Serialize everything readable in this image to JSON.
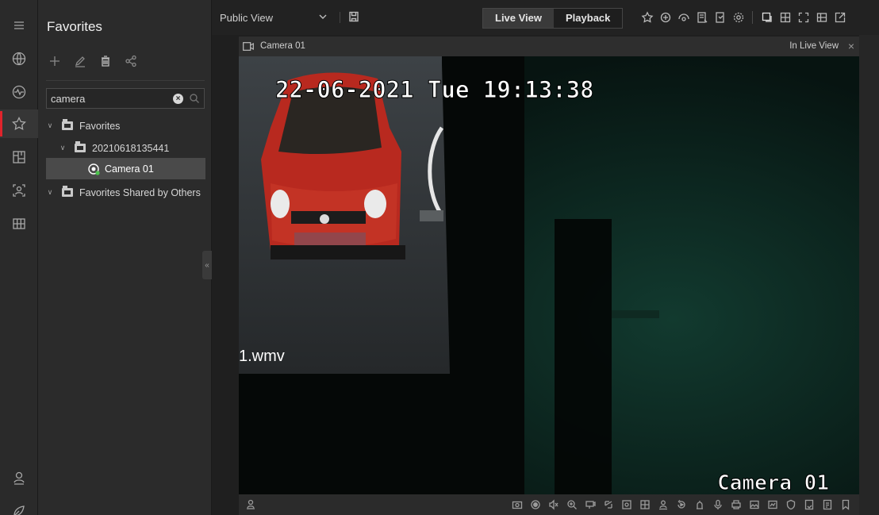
{
  "rail": {
    "items": [
      {
        "icon": "menu-icon"
      },
      {
        "icon": "globe-icon"
      },
      {
        "icon": "pulse-icon"
      },
      {
        "icon": "star-icon",
        "active": true
      },
      {
        "icon": "layout-icon"
      },
      {
        "icon": "person-scan-icon"
      },
      {
        "icon": "grid-icon"
      },
      {
        "icon": "user-icon"
      },
      {
        "icon": "settings-leaf-icon"
      }
    ]
  },
  "panel": {
    "title": "Favorites",
    "search": {
      "value": "camera",
      "placeholder": ""
    },
    "tree": [
      {
        "label": "Favorites",
        "level": 0
      },
      {
        "label": "20210618135441",
        "level": 1
      },
      {
        "label": "Camera 01",
        "level": 2,
        "selected": true
      },
      {
        "label": "Favorites Shared by Others",
        "level": 0
      }
    ],
    "collapse_glyph": "«"
  },
  "topbar": {
    "view_name": "Public View",
    "tabs": [
      {
        "label": "Live View",
        "active": true
      },
      {
        "label": "Playback",
        "active": false
      }
    ]
  },
  "video": {
    "window_title": "Camera 01",
    "status": "In Live View",
    "close_glyph": "×",
    "osd_datetime": "22-06-2021 Tue 19:13:38",
    "osd_filename": "1.wmv",
    "osd_camera": "Camera 01"
  },
  "colors": {
    "accent": "#e0242c",
    "background": "#1f1f1f",
    "panel": "#2b2b2b"
  }
}
